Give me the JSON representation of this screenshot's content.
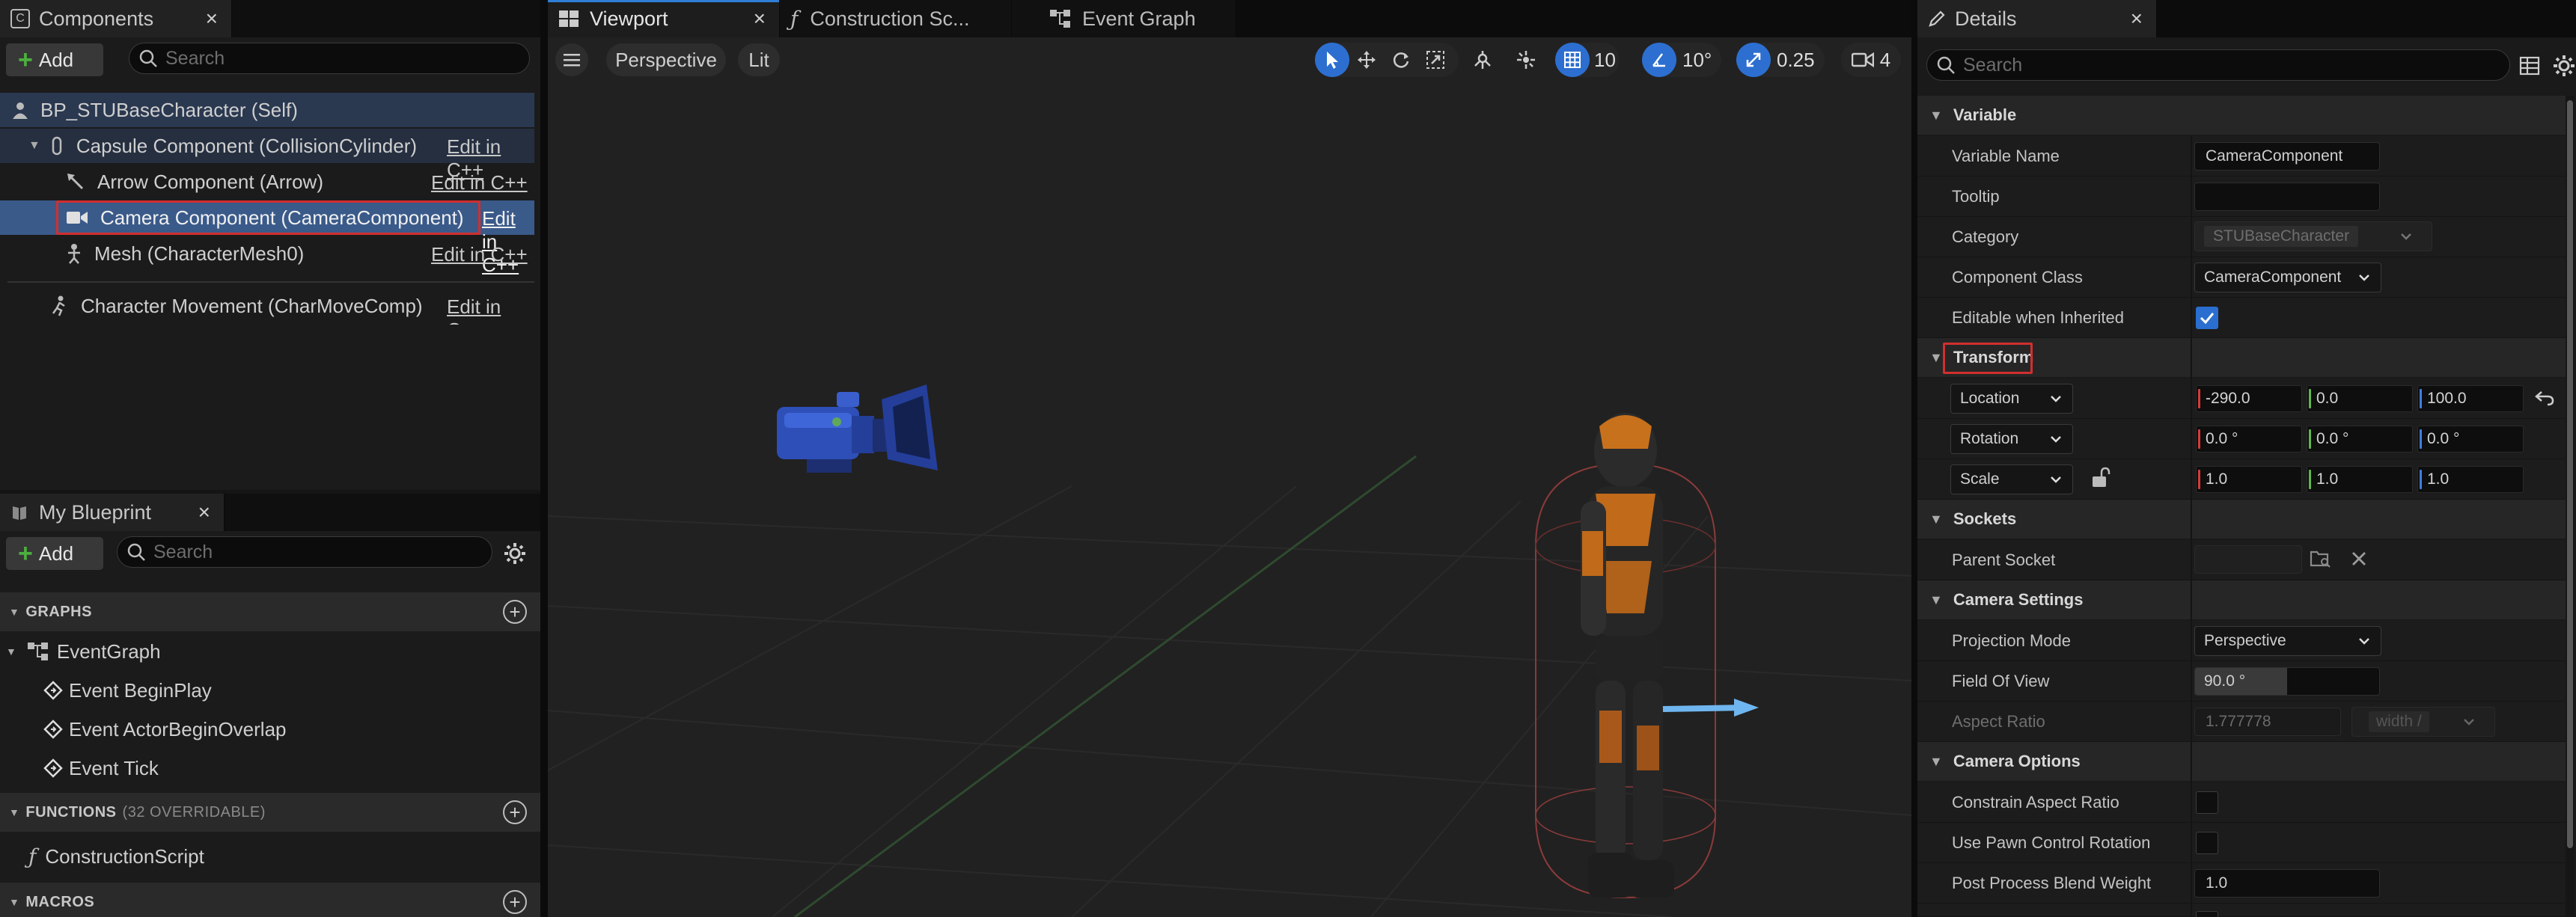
{
  "components_panel": {
    "tab_title": "Components",
    "close": "×",
    "add_label": "Add",
    "search_placeholder": "Search",
    "root_item": "BP_STUBaseCharacter (Self)",
    "items": [
      {
        "label": "Capsule Component (CollisionCylinder)",
        "edit": "Edit in C++"
      },
      {
        "label": "Arrow Component (Arrow)",
        "edit": "Edit in C++"
      },
      {
        "label": "Camera Component (CameraComponent)",
        "edit": "Edit in C++"
      },
      {
        "label": "Mesh (CharacterMesh0)",
        "edit": "Edit in C++"
      },
      {
        "label": "Character Movement (CharMoveComp)",
        "edit": "Edit in C++"
      }
    ]
  },
  "my_blueprint": {
    "tab_title": "My Blueprint",
    "close": "×",
    "add_label": "Add",
    "search_placeholder": "Search",
    "graphs_header": "GRAPHS",
    "event_graph": "EventGraph",
    "events": [
      "Event BeginPlay",
      "Event ActorBeginOverlap",
      "Event Tick"
    ],
    "functions_header": "FUNCTIONS",
    "functions_count": "(32 OVERRIDABLE)",
    "construction_script": "ConstructionScript",
    "macros_header": "MACROS"
  },
  "center_tabs": {
    "viewport": "Viewport",
    "construction": "Construction Sc...",
    "event_graph": "Event Graph",
    "close": "×"
  },
  "viewport_toolbar": {
    "perspective": "Perspective",
    "lit": "Lit",
    "grid_snap": "10",
    "rotation_snap": "10°",
    "scale_snap": "0.25",
    "camera_speed": "4"
  },
  "details_panel": {
    "tab_title": "Details",
    "close": "×",
    "search_placeholder": "Search",
    "sections": {
      "variable": "Variable",
      "transform": "Transform",
      "sockets": "Sockets",
      "camera_settings": "Camera Settings",
      "camera_options": "Camera Options"
    },
    "variable_name_label": "Variable Name",
    "variable_name_value": "CameraComponent",
    "tooltip_label": "Tooltip",
    "tooltip_value": "",
    "category_label": "Category",
    "category_value": "STUBaseCharacter",
    "component_class_label": "Component Class",
    "component_class_value": "CameraComponent",
    "editable_inherited_label": "Editable when Inherited",
    "editable_inherited_checked": true,
    "location_label": "Location",
    "location": [
      "-290.0",
      "0.0",
      "100.0"
    ],
    "rotation_label": "Rotation",
    "rotation": [
      "0.0 °",
      "0.0 °",
      "0.0 °"
    ],
    "scale_label": "Scale",
    "scale": [
      "1.0",
      "1.0",
      "1.0"
    ],
    "parent_socket_label": "Parent Socket",
    "parent_socket_value": "",
    "projection_mode_label": "Projection Mode",
    "projection_mode_value": "Perspective",
    "fov_label": "Field Of View",
    "fov_value": "90.0 °",
    "fov_fraction": 0.5,
    "aspect_ratio_label": "Aspect Ratio",
    "aspect_ratio_value": "1.777778",
    "aspect_ratio_axis": "width /",
    "constrain_aspect_label": "Constrain Aspect Ratio",
    "constrain_aspect_checked": false,
    "use_pawn_rotation_label": "Use Pawn Control Rotation",
    "use_pawn_rotation_checked": false,
    "post_process_label": "Post Process Blend Weight",
    "post_process_value": "1.0"
  },
  "colors": {
    "accent_blue": "#2f7fd8",
    "highlight_red": "#d12f2f",
    "x_axis": "#d43b3b",
    "y_axis": "#5fb84a",
    "z_axis": "#3f7fe0"
  }
}
